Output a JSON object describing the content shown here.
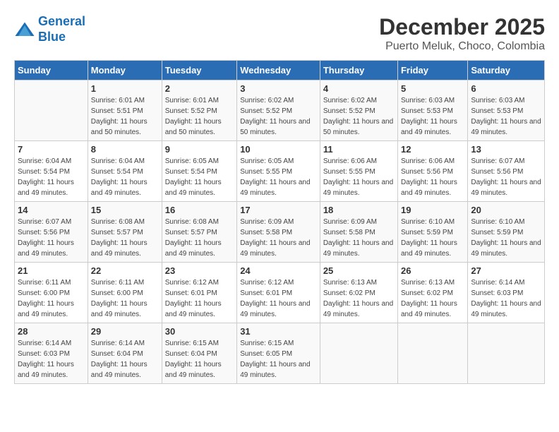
{
  "logo": {
    "line1": "General",
    "line2": "Blue"
  },
  "title": "December 2025",
  "subtitle": "Puerto Meluk, Choco, Colombia",
  "days_of_week": [
    "Sunday",
    "Monday",
    "Tuesday",
    "Wednesday",
    "Thursday",
    "Friday",
    "Saturday"
  ],
  "weeks": [
    [
      {
        "day": "",
        "sunrise": "",
        "sunset": "",
        "daylight": ""
      },
      {
        "day": "1",
        "sunrise": "6:01 AM",
        "sunset": "5:51 PM",
        "daylight": "11 hours and 50 minutes."
      },
      {
        "day": "2",
        "sunrise": "6:01 AM",
        "sunset": "5:52 PM",
        "daylight": "11 hours and 50 minutes."
      },
      {
        "day": "3",
        "sunrise": "6:02 AM",
        "sunset": "5:52 PM",
        "daylight": "11 hours and 50 minutes."
      },
      {
        "day": "4",
        "sunrise": "6:02 AM",
        "sunset": "5:52 PM",
        "daylight": "11 hours and 50 minutes."
      },
      {
        "day": "5",
        "sunrise": "6:03 AM",
        "sunset": "5:53 PM",
        "daylight": "11 hours and 49 minutes."
      },
      {
        "day": "6",
        "sunrise": "6:03 AM",
        "sunset": "5:53 PM",
        "daylight": "11 hours and 49 minutes."
      }
    ],
    [
      {
        "day": "7",
        "sunrise": "6:04 AM",
        "sunset": "5:54 PM",
        "daylight": "11 hours and 49 minutes."
      },
      {
        "day": "8",
        "sunrise": "6:04 AM",
        "sunset": "5:54 PM",
        "daylight": "11 hours and 49 minutes."
      },
      {
        "day": "9",
        "sunrise": "6:05 AM",
        "sunset": "5:54 PM",
        "daylight": "11 hours and 49 minutes."
      },
      {
        "day": "10",
        "sunrise": "6:05 AM",
        "sunset": "5:55 PM",
        "daylight": "11 hours and 49 minutes."
      },
      {
        "day": "11",
        "sunrise": "6:06 AM",
        "sunset": "5:55 PM",
        "daylight": "11 hours and 49 minutes."
      },
      {
        "day": "12",
        "sunrise": "6:06 AM",
        "sunset": "5:56 PM",
        "daylight": "11 hours and 49 minutes."
      },
      {
        "day": "13",
        "sunrise": "6:07 AM",
        "sunset": "5:56 PM",
        "daylight": "11 hours and 49 minutes."
      }
    ],
    [
      {
        "day": "14",
        "sunrise": "6:07 AM",
        "sunset": "5:56 PM",
        "daylight": "11 hours and 49 minutes."
      },
      {
        "day": "15",
        "sunrise": "6:08 AM",
        "sunset": "5:57 PM",
        "daylight": "11 hours and 49 minutes."
      },
      {
        "day": "16",
        "sunrise": "6:08 AM",
        "sunset": "5:57 PM",
        "daylight": "11 hours and 49 minutes."
      },
      {
        "day": "17",
        "sunrise": "6:09 AM",
        "sunset": "5:58 PM",
        "daylight": "11 hours and 49 minutes."
      },
      {
        "day": "18",
        "sunrise": "6:09 AM",
        "sunset": "5:58 PM",
        "daylight": "11 hours and 49 minutes."
      },
      {
        "day": "19",
        "sunrise": "6:10 AM",
        "sunset": "5:59 PM",
        "daylight": "11 hours and 49 minutes."
      },
      {
        "day": "20",
        "sunrise": "6:10 AM",
        "sunset": "5:59 PM",
        "daylight": "11 hours and 49 minutes."
      }
    ],
    [
      {
        "day": "21",
        "sunrise": "6:11 AM",
        "sunset": "6:00 PM",
        "daylight": "11 hours and 49 minutes."
      },
      {
        "day": "22",
        "sunrise": "6:11 AM",
        "sunset": "6:00 PM",
        "daylight": "11 hours and 49 minutes."
      },
      {
        "day": "23",
        "sunrise": "6:12 AM",
        "sunset": "6:01 PM",
        "daylight": "11 hours and 49 minutes."
      },
      {
        "day": "24",
        "sunrise": "6:12 AM",
        "sunset": "6:01 PM",
        "daylight": "11 hours and 49 minutes."
      },
      {
        "day": "25",
        "sunrise": "6:13 AM",
        "sunset": "6:02 PM",
        "daylight": "11 hours and 49 minutes."
      },
      {
        "day": "26",
        "sunrise": "6:13 AM",
        "sunset": "6:02 PM",
        "daylight": "11 hours and 49 minutes."
      },
      {
        "day": "27",
        "sunrise": "6:14 AM",
        "sunset": "6:03 PM",
        "daylight": "11 hours and 49 minutes."
      }
    ],
    [
      {
        "day": "28",
        "sunrise": "6:14 AM",
        "sunset": "6:03 PM",
        "daylight": "11 hours and 49 minutes."
      },
      {
        "day": "29",
        "sunrise": "6:14 AM",
        "sunset": "6:04 PM",
        "daylight": "11 hours and 49 minutes."
      },
      {
        "day": "30",
        "sunrise": "6:15 AM",
        "sunset": "6:04 PM",
        "daylight": "11 hours and 49 minutes."
      },
      {
        "day": "31",
        "sunrise": "6:15 AM",
        "sunset": "6:05 PM",
        "daylight": "11 hours and 49 minutes."
      },
      {
        "day": "",
        "sunrise": "",
        "sunset": "",
        "daylight": ""
      },
      {
        "day": "",
        "sunrise": "",
        "sunset": "",
        "daylight": ""
      },
      {
        "day": "",
        "sunrise": "",
        "sunset": "",
        "daylight": ""
      }
    ]
  ]
}
